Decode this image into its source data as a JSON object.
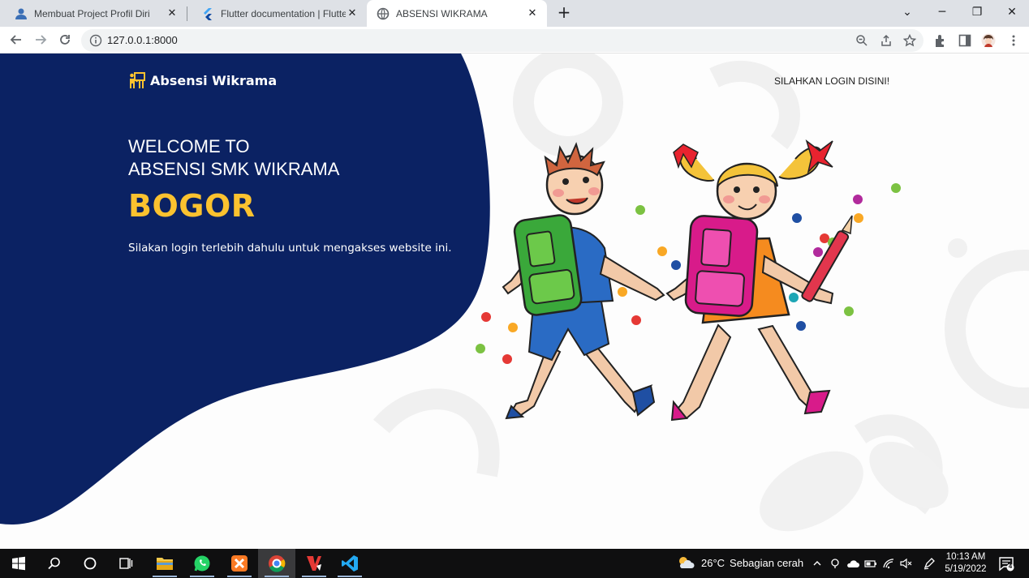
{
  "browser": {
    "tabs": [
      {
        "title": "Membuat Project Profil Diri",
        "icon": "profile-favicon"
      },
      {
        "title": "Flutter documentation | Flutter",
        "icon": "flutter-favicon"
      },
      {
        "title": "ABSENSI WIKRAMA",
        "icon": "globe-favicon",
        "active": true
      }
    ],
    "url": "127.0.0.1:8000"
  },
  "page": {
    "brand": "Absensi Wikrama",
    "login_link": "SILAHKAN LOGIN DISINI!",
    "welcome_line1": "WELCOME TO",
    "welcome_line2": "ABSENSI SMK WIKRAMA",
    "city": "BOGOR",
    "subtitle": "Silakan login terlebih dahulu untuk mengakses website ini.",
    "colors": {
      "navy": "#0b2263",
      "accent": "#fbc22f"
    }
  },
  "taskbar": {
    "apps": [
      "windows-start",
      "search",
      "cortana",
      "task-view",
      "file-explorer",
      "whatsapp",
      "xampp",
      "chrome",
      "vscode-alt",
      "vscode"
    ],
    "weather": {
      "temp": "26°C",
      "condition": "Sebagian cerah"
    },
    "time": "10:13 AM",
    "date": "5/19/2022",
    "notification_count": "4"
  }
}
